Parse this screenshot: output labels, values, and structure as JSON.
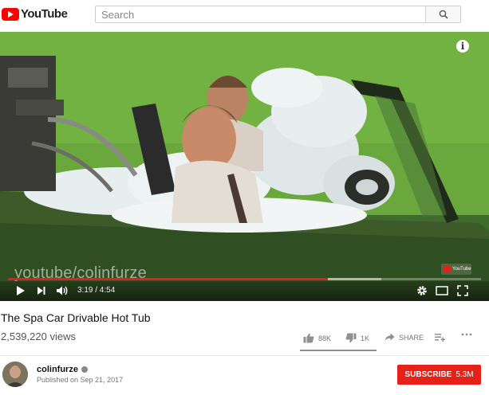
{
  "header": {
    "logo_text": "YouTube",
    "search": {
      "placeholder": "Search",
      "value": ""
    }
  },
  "player": {
    "watermark": "youtube/colinfurze",
    "info_icon": "i",
    "badge_text": "YouTube",
    "current_time": "3:19",
    "duration": "4:54",
    "time_display": "3:19 / 4:54",
    "progress_fraction": 0.677,
    "buffered_fraction": 0.79,
    "accent": "#e0201b"
  },
  "video": {
    "title": "The Spa Car Drivable Hot Tub",
    "views": "2,539,220 views",
    "likes": "88K",
    "dislikes": "1K",
    "share_label": "SHARE"
  },
  "channel": {
    "name": "colinfurze",
    "published": "Published on Sep 21, 2017",
    "subscribe_label": "SUBSCRIBE",
    "subscriber_count": "5.3M",
    "subscribe_color": "#e62117"
  },
  "icons": [
    "youtube-logo-icon",
    "search-icon",
    "info-icon",
    "play-icon",
    "next-icon",
    "volume-icon",
    "settings-icon",
    "miniplayer-icon",
    "fullscreen-icon",
    "thumbs-up-icon",
    "thumbs-down-icon",
    "share-icon",
    "add-to-playlist-icon",
    "more-icon",
    "verified-icon"
  ]
}
